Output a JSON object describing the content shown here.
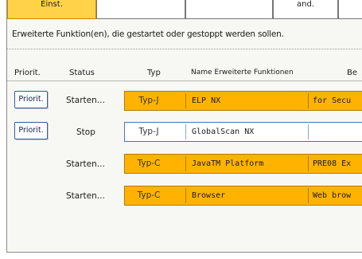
{
  "tabs": [
    {
      "label": "Einst."
    },
    {
      "label": ""
    },
    {
      "label": ""
    },
    {
      "label": "and."
    },
    {
      "label": ""
    }
  ],
  "instruction": "Erweiterte Funktion(en), die gestartet oder gestoppt werden sollen.",
  "columns": {
    "priority": "Priorit.",
    "status": "Status",
    "type": "Typ",
    "name": "Name Erweiterte Funktionen",
    "description": "Be"
  },
  "rows": [
    {
      "priority_label": "Priorit.",
      "status": "Starten...",
      "type": "Typ-J",
      "name": "ELP NX",
      "description": "for Secu",
      "state": "running"
    },
    {
      "priority_label": "Priorit.",
      "status": "Stop",
      "type": "Typ-J",
      "name": "GlobalScan NX",
      "description": "",
      "state": "stopped"
    },
    {
      "priority_label": "",
      "status": "Starten...",
      "type": "Typ-C",
      "name": "JavaTM Platform",
      "description": "PRE08 Ex",
      "state": "running"
    },
    {
      "priority_label": "",
      "status": "Starten...",
      "type": "Typ-C",
      "name": "Browser",
      "description": "Web brow",
      "state": "running"
    }
  ],
  "colors": {
    "running_fill": "#ffb300",
    "stopped_fill": "#ffffff",
    "button_border": "#3a5a9a",
    "tab_active": "#ffd24a"
  }
}
